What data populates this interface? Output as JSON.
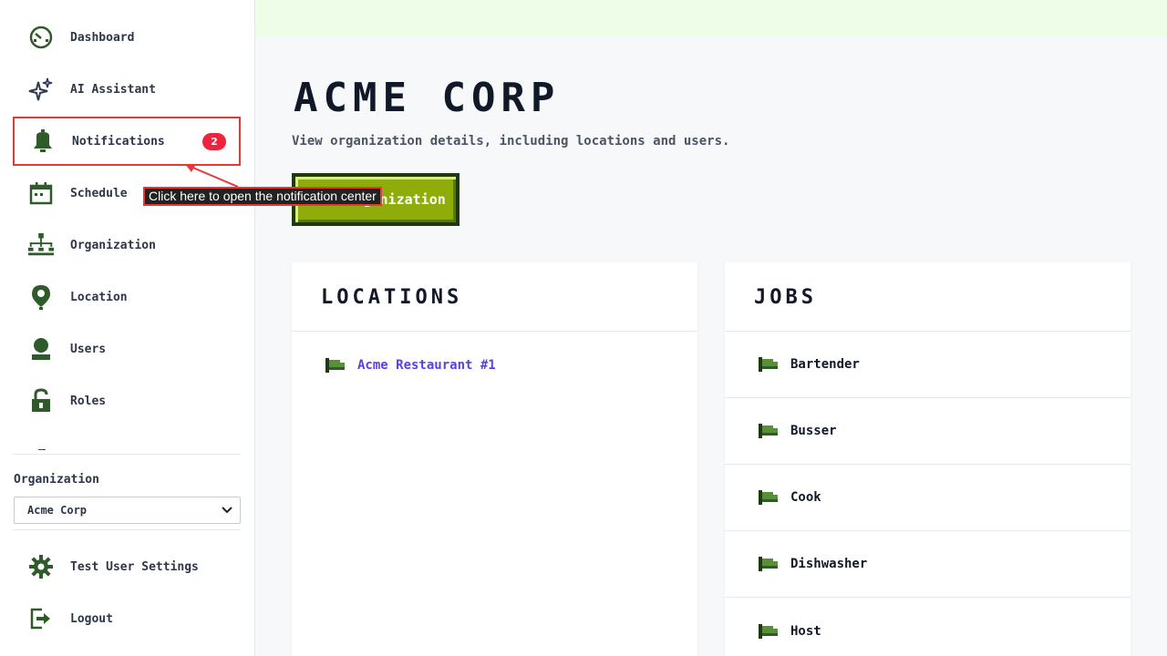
{
  "sidebar": {
    "nav": [
      {
        "id": "dashboard",
        "label": "Dashboard",
        "icon": "dashboard-gauge-icon"
      },
      {
        "id": "ai-assistant",
        "label": "AI Assistant",
        "icon": "sparkle-icon"
      },
      {
        "id": "notifications",
        "label": "Notifications",
        "icon": "bell-icon",
        "badge": "2"
      },
      {
        "id": "schedule",
        "label": "Schedule",
        "icon": "calendar-icon"
      },
      {
        "id": "organization",
        "label": "Organization",
        "icon": "org-chart-icon"
      },
      {
        "id": "location",
        "label": "Location",
        "icon": "map-pin-icon"
      },
      {
        "id": "users",
        "label": "Users",
        "icon": "user-icon"
      },
      {
        "id": "roles",
        "label": "Roles",
        "icon": "unlock-icon"
      }
    ],
    "organization_label": "Organization",
    "organization_selected": "Acme Corp",
    "footer": [
      {
        "id": "test-user-settings",
        "label": "Test User Settings",
        "icon": "gear-icon"
      },
      {
        "id": "logout",
        "label": "Logout",
        "icon": "logout-icon"
      }
    ]
  },
  "tooltip": {
    "text": "Click here to open the notification center"
  },
  "main": {
    "title": "Acme Corp",
    "subtitle": "View organization details, including locations and users.",
    "edit_button": "Edit Organization"
  },
  "locations": {
    "title": "Locations",
    "items": [
      "Acme Restaurant #1"
    ]
  },
  "jobs": {
    "title": "Jobs",
    "items": [
      "Bartender",
      "Busser",
      "Cook",
      "Dishwasher",
      "Host"
    ]
  },
  "colors": {
    "icon_green": "#2f5a2a",
    "accent_lime": "#8fad0a",
    "badge_red": "#ef233c",
    "link_purple": "#5b3ef0",
    "highlight_red": "#e53935"
  }
}
